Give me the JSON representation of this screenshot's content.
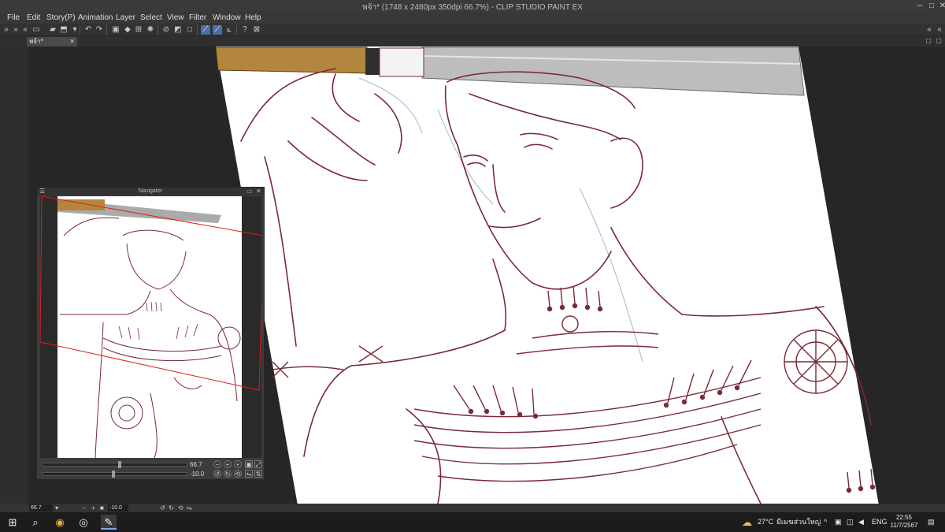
{
  "window": {
    "title": "พจ้า* (1748 x 2480px 350dpi 66.7%)  - CLIP STUDIO PAINT EX"
  },
  "menu": {
    "items": [
      "File",
      "Edit",
      "Story(P)",
      "Animation",
      "Layer",
      "Select",
      "View",
      "Filter",
      "Window",
      "Help"
    ]
  },
  "tab": {
    "label": "พจ้า*"
  },
  "navigator": {
    "title": "Navigator",
    "zoom": "66.7",
    "rotation": "-10.0"
  },
  "statusbar": {
    "zoom": "66.7",
    "angle": "-10.0"
  },
  "taskbar": {
    "weather_temp": "27°C",
    "weather_text": "มีเมฆส่วนใหญ่",
    "language": "ENG",
    "time": "22:55",
    "date": "11/7/2567"
  },
  "colors": {
    "ink": "#7a2a36",
    "sketch_blue": "#9bb8d9",
    "accent": "#4a6fa5"
  }
}
